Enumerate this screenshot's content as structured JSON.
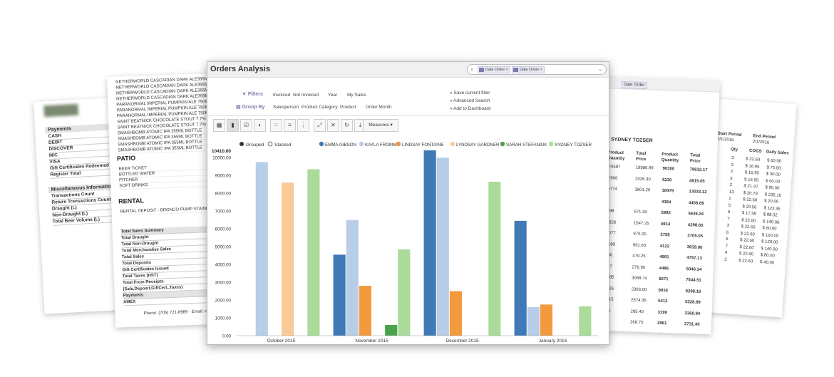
{
  "receipt": {
    "payments_header": "Payments",
    "payment_rows": [
      "CASH",
      "DEBIT",
      "DISCOVER",
      "M/C",
      "VISA",
      "Gift Certificates Redeemed",
      "Register Total"
    ],
    "misc_header": "Miscellaneous Information",
    "misc_rows": [
      "Transactions Count",
      "Return Transactions Count",
      "Draught (L)",
      "Non-Draught (L)",
      "Total Beer Volume (L)"
    ]
  },
  "products_sheet": {
    "lines_top": [
      "NETHERWORLD CASCADIAN DARK ALE355ML",
      "NETHERWORLD CASCADIAN DARK ALE355ML",
      "NETHERWORLD CASCADIAN DARK ALE355ML",
      "NETHERWORLD CASCADIAN DARK ALE355ML",
      "PARANORMAL IMPERIAL PUMPKIN ALE 750ML",
      "PARANORMAL IMPERIAL PUMPKIN ALE 750ML",
      "PARANORMAL IMPERIAL PUMPKIN ALE 750ML",
      "SAINT BEATNICK CHOCOLATE STOUT 7.7%",
      "SAINT BEATNICK CHOCOLATE STOUT 7.7%",
      "SMASHBOMB ATOMIC IPA 355ML BOTTLE",
      "SMASHBOMB ATOMIC IPA 355ML BOTTLE",
      "SMASHBOMB ATOMIC IPA 355ML BOTTLE",
      "SMASHBOMB ATOMIC IPA 355ML BOTTLE"
    ],
    "patio_title": "PATIO",
    "patio_lines": [
      "BEER TICKET",
      "BOTTLED WATER",
      "PITCHER",
      "SOFT DRINKS"
    ],
    "rental_title": "RENTAL",
    "rental_lines": [
      "RENTAL DEPOSIT - BRONCO PUMP STAINLESS"
    ],
    "summary_header": "Total Sales Summary",
    "summary_rows": [
      "Total Draught",
      "Total Non-Draught",
      "Total Merchandise Sales",
      "Total Sales",
      "Total Deposits",
      "Gift Certificates Issued",
      "Total Taxes (HST)",
      "Total From Receipts-",
      "(Sale,Deposit,GiftCert.,Taxes)"
    ],
    "payments_header": "Payments",
    "payments_rows": [
      "AMEX"
    ],
    "footer": "Phone: (705) 721-8989  ·  Email: info"
  },
  "right_sheet": {
    "facet": "Date Order",
    "person": "SYDNEY TOZSER",
    "headers": [
      "Product Quantity",
      "Total Price",
      "Product Quantity",
      "Total Price"
    ],
    "rows": [
      [
        "24587",
        "19986.99",
        "90300",
        "79632.17"
      ],
      [
        "2606",
        "2026.30",
        "5230",
        "4815.05"
      ],
      [
        "6774",
        "3801.20",
        "18479",
        "13033.12"
      ],
      [
        "",
        "",
        "4394",
        "4456.89"
      ],
      [
        "898",
        "671.30",
        "5993",
        "5636.24"
      ],
      [
        "1826",
        "1547.25",
        "4914",
        "4298.60"
      ],
      [
        "1077",
        "970.20",
        "3755",
        "3705.05"
      ],
      [
        "1099",
        "991.60",
        "4122",
        "3619.00"
      ],
      [
        "430",
        "479.25",
        "4991",
        "4757.13"
      ],
      [
        "227",
        "276.90",
        "4486",
        "5046.34"
      ],
      [
        "3985",
        "3088.74",
        "8271",
        "7544.51"
      ],
      [
        "1926",
        "2366.00",
        "9916",
        "9298.16"
      ],
      [
        "2515",
        "2574.35",
        "5413",
        "5328.89"
      ],
      [
        "236",
        "285.40",
        "3199",
        "2360.94"
      ],
      [
        "231",
        "268.75",
        "2861",
        "2731.45"
      ],
      [
        "767",
        "639.75",
        "4274",
        "3790.80"
      ]
    ]
  },
  "far_right_sheet": {
    "start_label": "Start Period",
    "end_label": "End Period",
    "start_value": "2/1/2016",
    "end_value": "2/1/2016",
    "cols": [
      "Qty",
      "COGS",
      "Daily Sales"
    ],
    "rows": [
      [
        "3",
        "$ 22.60",
        "$ 60.00"
      ],
      [
        "3",
        "$ 16.95",
        "$ 75.00"
      ],
      [
        "2",
        "$ 16.95",
        "$ 30.00"
      ],
      [
        "3",
        "$ 16.95",
        "$ 60.00"
      ],
      [
        "2",
        "$ 21.47",
        "$ 95.00"
      ],
      [
        "13",
        "$ 20.79",
        "$ 235.16"
      ],
      [
        "1",
        "$ 22.60",
        "$ 20.00"
      ],
      [
        "5",
        "$ 20.56",
        "$ 123.35"
      ],
      [
        "6",
        "$ 17.58",
        "$ 88.32"
      ],
      [
        "7",
        "$ 22.60",
        "$ 140.00"
      ],
      [
        "3",
        "$ 22.60",
        "$ 60.00"
      ],
      [
        "6",
        "$ 22.60",
        "$ 120.00"
      ],
      [
        "6",
        "$ 22.60",
        "$ 120.00"
      ],
      [
        "7",
        "$ 22.60",
        "$ 140.00"
      ],
      [
        "4",
        "$ 22.60",
        "$ 80.00"
      ],
      [
        "2",
        "$ 22.60",
        "$ 40.00"
      ]
    ]
  },
  "window": {
    "title": "Orders Analysis",
    "search_facets": [
      "Date Order",
      "Date Order"
    ],
    "filters_label": "Filters",
    "filter_items": [
      "Invoiced",
      "Not Invoiced",
      "Year",
      "My Sales"
    ],
    "groupby_label": "Group By",
    "groupby_items": [
      "Salesperson",
      "Product Category",
      "Product",
      "Order Month"
    ],
    "favorites": [
      "» Save current filter",
      "» Advanced Search",
      "» Add to Dashboard"
    ],
    "toolbar_icons": [
      "table-icon",
      "bar-chart-icon",
      "check-icon",
      "pie-chart-icon",
      "grid-icon",
      "list-icon",
      "columns-icon",
      "expand-icon",
      "collapse-icon",
      "refresh-icon",
      "download-icon"
    ],
    "measures_label": "Measures ▾",
    "grouped_label": "Grouped",
    "stacked_label": "Stacked"
  },
  "chart_data": {
    "type": "bar",
    "categories": [
      "October 2015",
      "November 2015",
      "December 2015",
      "January 2016"
    ],
    "ylim": [
      0,
      10410
    ],
    "y_max_label": "10410.00",
    "y_ticks": [
      "0.00",
      "1000.00",
      "2000.00",
      "3000.00",
      "4000.00",
      "5000.00",
      "6000.00",
      "7000.00",
      "8000.00",
      "9000.00",
      "10000.00"
    ],
    "mode": "grouped",
    "series": [
      {
        "name": "EMMA GIBSON",
        "color": "#3f7ab6",
        "values": [
          0,
          4550,
          10410,
          6450
        ]
      },
      {
        "name": "KAYLA FROMM",
        "color": "#b7cde8",
        "values": [
          9750,
          6500,
          10000,
          1600
        ]
      },
      {
        "name": "LINDSAY FONTAINE",
        "color": "#f29a3d",
        "values": [
          0,
          2800,
          2500,
          1750
        ]
      },
      {
        "name": "LYNDSAY GARDNER",
        "color": "#f9c997",
        "values": [
          8600,
          0,
          0,
          0
        ]
      },
      {
        "name": "SARAH STEFANIUK",
        "color": "#4aa24a",
        "values": [
          0,
          600,
          0,
          0
        ]
      },
      {
        "name": "SYDNEY TOZSER",
        "color": "#aadb9b",
        "values": [
          9350,
          4850,
          8650,
          1650
        ]
      }
    ]
  }
}
